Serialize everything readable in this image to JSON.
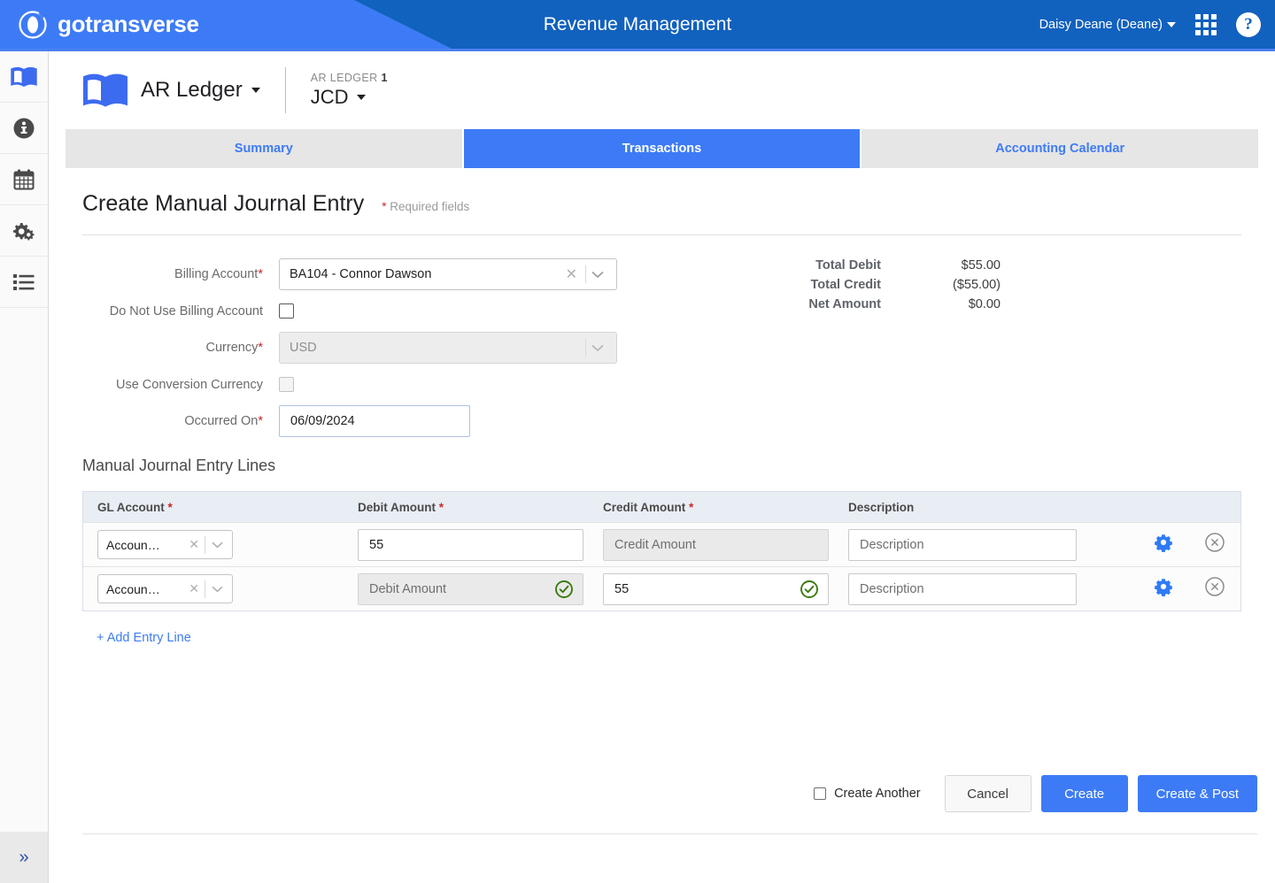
{
  "header": {
    "brand": "gotransverse",
    "brand_icon": "gotransverse-logo-icon",
    "title": "Revenue Management",
    "user": "Daisy Deane (Deane)",
    "apps_icon": "grid-apps-icon",
    "help_icon": "help-question-icon",
    "colors": {
      "primary": "#1161BE",
      "accent": "#3D7BF6"
    }
  },
  "sidebar": {
    "items": [
      {
        "icon": "ledger-book-icon",
        "name": "ledger",
        "active": true
      },
      {
        "icon": "info-circle-icon",
        "name": "info",
        "active": false
      },
      {
        "icon": "calendar-icon",
        "name": "calendar",
        "active": false
      },
      {
        "icon": "gears-settings-icon",
        "name": "settings",
        "active": false
      },
      {
        "icon": "list-icon",
        "name": "list",
        "active": false
      }
    ],
    "expand_label": "»"
  },
  "ledger": {
    "icon": "open-book-icon",
    "name": "AR Ledger",
    "meta_label": "AR LEDGER",
    "meta_number": "1",
    "meta_value": "JCD"
  },
  "tabs": [
    {
      "label": "Summary",
      "active": false
    },
    {
      "label": "Transactions",
      "active": true
    },
    {
      "label": "Accounting Calendar",
      "active": false
    }
  ],
  "page": {
    "title": "Create Manual Journal Entry",
    "required_note": "Required fields",
    "required_star": "*"
  },
  "form": {
    "billing_account": {
      "label": "Billing Account",
      "required": true,
      "value": "BA104 - Connor Dawson",
      "clear_icon": "clear-x-icon",
      "chevron_icon": "chevron-down-icon"
    },
    "do_not_use_billing_account": {
      "label": "Do Not Use Billing Account",
      "checked": false
    },
    "currency": {
      "label": "Currency",
      "required": true,
      "value": "USD",
      "disabled": true,
      "chevron_icon": "chevron-down-icon"
    },
    "use_conversion_currency": {
      "label": "Use Conversion Currency",
      "checked": false,
      "disabled": true
    },
    "occurred_on": {
      "label": "Occurred On",
      "required": true,
      "value": "06/09/2024"
    }
  },
  "totals": [
    {
      "label": "Total Debit",
      "value": "$55.00"
    },
    {
      "label": "Total Credit",
      "value": "($55.00)"
    },
    {
      "label": "Net Amount",
      "value": "$0.00"
    }
  ],
  "lines": {
    "section_title": "Manual Journal Entry Lines",
    "columns": [
      {
        "label": "GL Account",
        "required": true
      },
      {
        "label": "Debit Amount",
        "required": true
      },
      {
        "label": "Credit Amount",
        "required": true
      },
      {
        "label": "Description",
        "required": false
      }
    ],
    "add_line_label": "+ Add Entry Line",
    "gear_icon": "gear-settings-icon",
    "delete_icon": "remove-circle-icon",
    "valid_icon": "check-circle-icon",
    "rows": [
      {
        "gl_account": "Accoun…",
        "debit": {
          "value": "55",
          "placeholder": "Debit Amount",
          "readonly": false,
          "valid": false
        },
        "credit": {
          "value": "",
          "placeholder": "Credit Amount",
          "readonly": true,
          "valid": false
        },
        "description": {
          "value": "",
          "placeholder": "Description"
        }
      },
      {
        "gl_account": "Accoun…",
        "debit": {
          "value": "",
          "placeholder": "Debit Amount",
          "readonly": true,
          "valid": true
        },
        "credit": {
          "value": "55",
          "placeholder": "Credit Amount",
          "readonly": false,
          "valid": true
        },
        "description": {
          "value": "",
          "placeholder": "Description"
        }
      }
    ]
  },
  "footer": {
    "create_another_label": "Create Another",
    "create_another_checked": false,
    "cancel_label": "Cancel",
    "create_label": "Create",
    "create_post_label": "Create & Post"
  }
}
